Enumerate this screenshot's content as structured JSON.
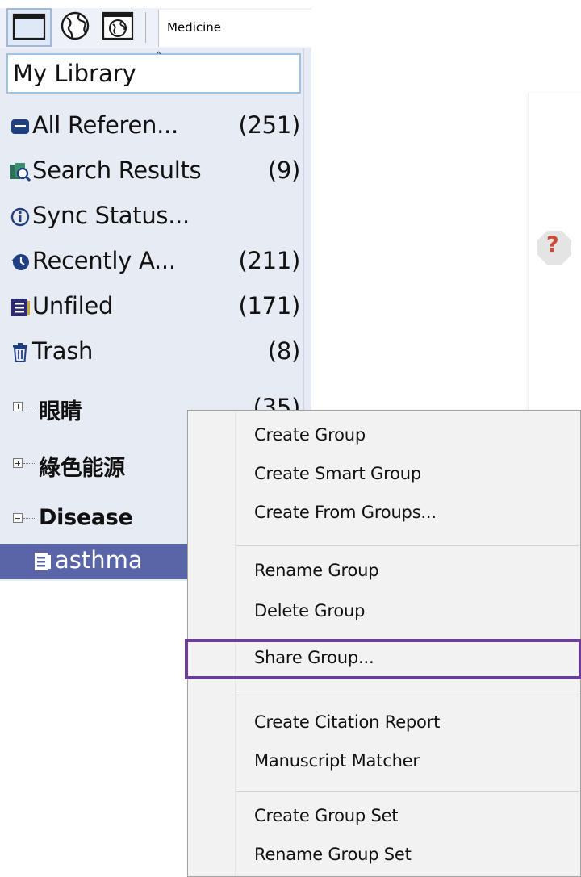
{
  "toolbar": {
    "buttons": [
      {
        "name": "local-library-icon"
      },
      {
        "name": "online-search-icon"
      },
      {
        "name": "integrated-library-icon"
      }
    ],
    "output_style": "Medicine"
  },
  "library": {
    "header": "My Library",
    "items": [
      {
        "label": "All Referen...",
        "count": "(251)",
        "icon": "all-references-icon"
      },
      {
        "label": "Search Results",
        "count": "(9)",
        "icon": "search-results-icon"
      },
      {
        "label": "Sync Status...",
        "count": "",
        "icon": "info-icon"
      },
      {
        "label": "Recently A...",
        "count": "(211)",
        "icon": "history-icon"
      },
      {
        "label": "Unfiled",
        "count": "(171)",
        "icon": "unfiled-icon"
      },
      {
        "label": "Trash",
        "count": "(8)",
        "icon": "trash-icon"
      }
    ],
    "group_sets": [
      {
        "label": "眼睛",
        "count": "(35)",
        "expanded": false
      },
      {
        "label": "綠色能源",
        "count": "",
        "expanded": false
      },
      {
        "label": "Disease",
        "count": "",
        "expanded": true
      }
    ],
    "selected_group": {
      "label": "asthma",
      "count": ""
    }
  },
  "context_menu": {
    "sections": [
      [
        "Create Group",
        "Create Smart Group",
        "Create From Groups..."
      ],
      [
        "Rename Group",
        "Delete Group"
      ],
      [
        "Share Group..."
      ],
      [
        "Create Citation Report",
        "Manuscript Matcher"
      ],
      [
        "Create Group Set",
        "Rename Group Set"
      ]
    ],
    "highlighted": "Share Group..."
  },
  "colors": {
    "panel_bg": "#e7ebf4",
    "selection": "#5a65a8",
    "highlight_outline": "#6a3d96",
    "menu_bg": "#f2f2f2"
  }
}
